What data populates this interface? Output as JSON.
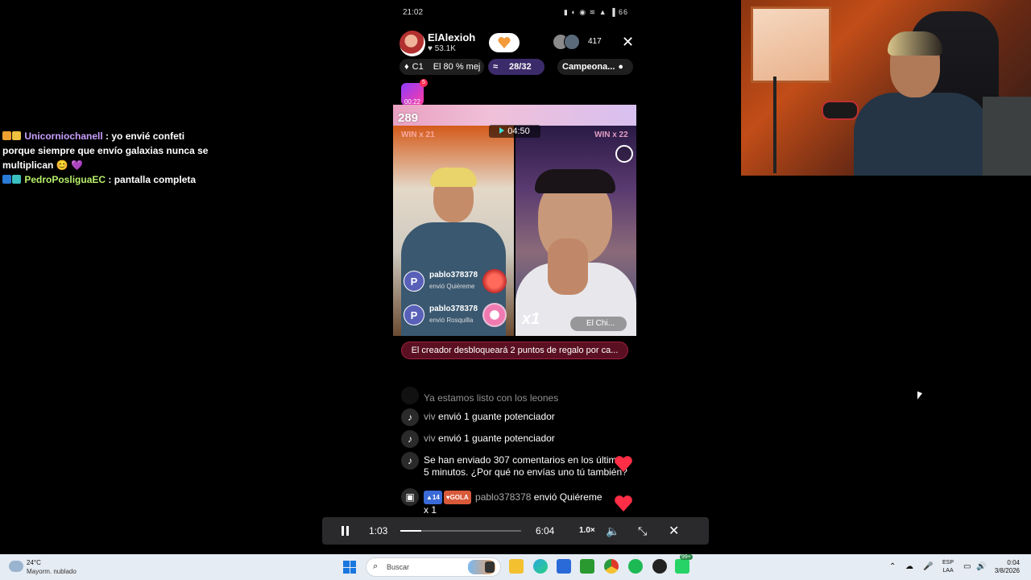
{
  "overlay_chat": [
    {
      "user": "Unicorniochanell",
      "message": ": yo envié confeti porque siempre que envío galaxias nunca se multiplican 😊 💜"
    },
    {
      "user": "PedroPosliguaEC",
      "message": ": pantalla completa"
    }
  ],
  "status_bar": {
    "time": "21:02",
    "battery": "66"
  },
  "host": {
    "name": "ElAlexioh",
    "likes": "53.1K",
    "viewer_count": "417"
  },
  "info_row": {
    "rank": "C1",
    "rank_text": "El 80 % mej",
    "progress": "28/32",
    "campaign": "Campeona..."
  },
  "mini_stream": {
    "time": "00:22",
    "badge": "5"
  },
  "battle": {
    "score": "289",
    "win_left": "WIN x 21",
    "win_right": "WIN x 22",
    "timer": "04:50",
    "multiplier": "x1",
    "opponent_name": "El Chi...",
    "gifts": [
      {
        "initial": "P",
        "user": "pablo378378",
        "action": "envió",
        "gift": "Quiéreme"
      },
      {
        "initial": "P",
        "user": "pablo378378",
        "action": "envió",
        "gift": "Rosquilla"
      }
    ]
  },
  "notice": "El creador desbloqueará 2 puntos de regalo por ca...",
  "stream_chat": [
    {
      "text": "Ya estamos listo con los leones"
    },
    {
      "user": "viv",
      "text": "envió 1 guante potenciador"
    },
    {
      "user": "viv",
      "text": "envió 1 guante potenciador"
    },
    {
      "text": "Se han enviado 307 comentarios en los últimos 5 minutos. ¿Por qué no envías uno tú también?"
    },
    {
      "badge_level": "14",
      "badge_fan": "GOLA",
      "user": "pablo378378",
      "text": "envió Quiéreme",
      "count": "x 1"
    }
  ],
  "player": {
    "current": "1:03",
    "duration": "6:04",
    "speed": "1.0×",
    "progress": 0.17
  },
  "taskbar": {
    "weather_temp": "24°C",
    "weather_desc": "Mayorm. nublado",
    "search_placeholder": "Buscar",
    "notif_count": "99+",
    "lang_top": "ESP",
    "lang_bottom": "LAA",
    "time": "0:04",
    "date": "3/8/2026"
  },
  "colors": {
    "accent_purple": "#3c2b6a",
    "notice_red": "#5a1020",
    "heart_red": "#ff2d45",
    "taskbar_bg": "#e6ecf3"
  }
}
